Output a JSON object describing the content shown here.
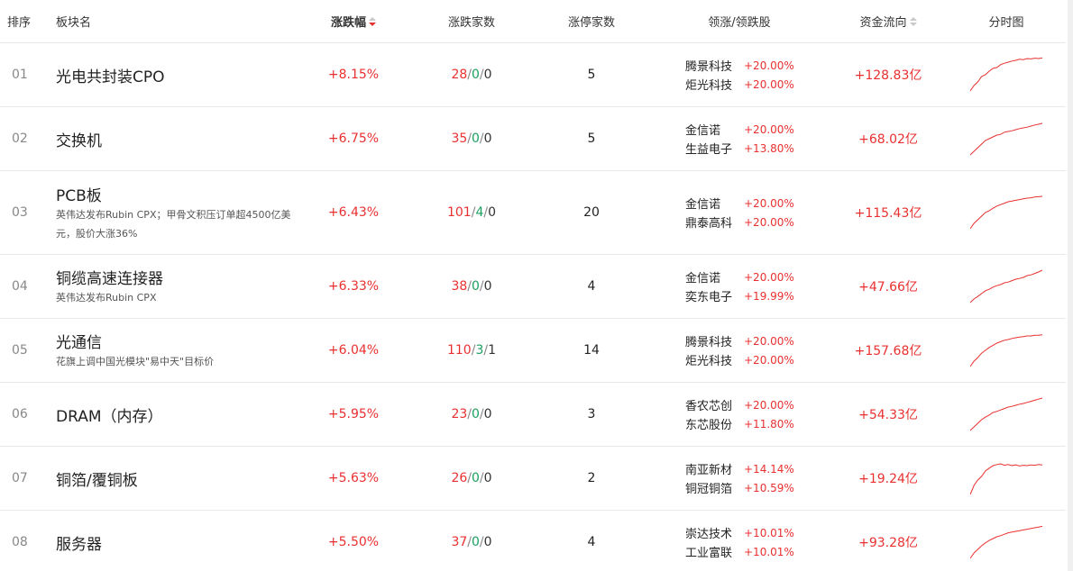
{
  "headers": {
    "rank": "排序",
    "name": "板块名",
    "change": "涨跌幅",
    "count": "涨跌家数",
    "limit_up": "涨停家数",
    "leaders": "领涨/领跌股",
    "flow": "资金流向",
    "timeline": "分时图"
  },
  "rows": [
    {
      "rank": "01",
      "name": "光电共封装CPO",
      "sub": "",
      "change": "+8.15%",
      "up": "28",
      "flat": "0",
      "down": "0",
      "limit": "5",
      "leader1": "腾景科技",
      "leader1_pct": "+20.00%",
      "leader2": "炬光科技",
      "leader2_pct": "+20.00%",
      "flow": "+128.83亿",
      "spark": [
        0.05,
        0.2,
        0.3,
        0.45,
        0.5,
        0.6,
        0.68,
        0.7,
        0.78,
        0.82,
        0.85,
        0.88,
        0.9,
        0.93,
        0.92,
        0.95,
        0.94,
        0.96,
        0.95,
        0.97
      ]
    },
    {
      "rank": "02",
      "name": "交换机",
      "sub": "",
      "change": "+6.75%",
      "up": "35",
      "flat": "0",
      "down": "0",
      "limit": "5",
      "leader1": "金信诺",
      "leader1_pct": "+20.00%",
      "leader2": "生益电子",
      "leader2_pct": "+13.80%",
      "flow": "+68.02亿",
      "spark": [
        0.05,
        0.15,
        0.25,
        0.35,
        0.45,
        0.5,
        0.55,
        0.6,
        0.62,
        0.68,
        0.7,
        0.72,
        0.75,
        0.78,
        0.8,
        0.82,
        0.85,
        0.88,
        0.9,
        0.93
      ]
    },
    {
      "rank": "03",
      "name": "PCB板",
      "sub": "英伟达发布Rubin CPX；甲骨文积压订单超4500亿美元，股价大涨36%",
      "change": "+6.43%",
      "up": "101",
      "flat": "4",
      "down": "0",
      "limit": "20",
      "leader1": "金信诺",
      "leader1_pct": "+20.00%",
      "leader2": "鼎泰高科",
      "leader2_pct": "+20.00%",
      "flow": "+115.43亿",
      "spark": [
        0.05,
        0.2,
        0.3,
        0.4,
        0.5,
        0.55,
        0.62,
        0.68,
        0.72,
        0.76,
        0.8,
        0.82,
        0.84,
        0.86,
        0.88,
        0.9,
        0.91,
        0.93,
        0.94,
        0.95
      ]
    },
    {
      "rank": "04",
      "name": "铜缆高速连接器",
      "sub": "英伟达发布Rubin CPX",
      "change": "+6.33%",
      "up": "38",
      "flat": "0",
      "down": "0",
      "limit": "4",
      "leader1": "金信诺",
      "leader1_pct": "+20.00%",
      "leader2": "奕东电子",
      "leader2_pct": "+19.99%",
      "flow": "+47.66亿",
      "spark": [
        0.05,
        0.15,
        0.22,
        0.3,
        0.38,
        0.42,
        0.48,
        0.52,
        0.55,
        0.6,
        0.62,
        0.66,
        0.7,
        0.72,
        0.75,
        0.8,
        0.82,
        0.86,
        0.9,
        0.95
      ]
    },
    {
      "rank": "05",
      "name": "光通信",
      "sub": "花旗上调中国光模块\"易中天\"目标价",
      "change": "+6.04%",
      "up": "110",
      "flat": "3",
      "down": "1",
      "limit": "14",
      "leader1": "腾景科技",
      "leader1_pct": "+20.00%",
      "leader2": "炬光科技",
      "leader2_pct": "+20.00%",
      "flow": "+157.68亿",
      "spark": [
        0.05,
        0.2,
        0.3,
        0.42,
        0.5,
        0.58,
        0.64,
        0.7,
        0.74,
        0.78,
        0.8,
        0.83,
        0.85,
        0.87,
        0.88,
        0.9,
        0.9,
        0.92,
        0.92,
        0.93
      ]
    },
    {
      "rank": "06",
      "name": "DRAM（内存）",
      "sub": "",
      "change": "+5.95%",
      "up": "23",
      "flat": "0",
      "down": "0",
      "limit": "3",
      "leader1": "香农芯创",
      "leader1_pct": "+20.00%",
      "leader2": "东芯股份",
      "leader2_pct": "+11.80%",
      "flow": "+54.33亿",
      "spark": [
        0.05,
        0.15,
        0.25,
        0.35,
        0.42,
        0.48,
        0.55,
        0.58,
        0.62,
        0.66,
        0.7,
        0.72,
        0.75,
        0.78,
        0.8,
        0.83,
        0.86,
        0.89,
        0.92,
        0.95
      ]
    },
    {
      "rank": "07",
      "name": "铜箔/覆铜板",
      "sub": "",
      "change": "+5.63%",
      "up": "26",
      "flat": "0",
      "down": "0",
      "limit": "2",
      "leader1": "南亚新材",
      "leader1_pct": "+14.14%",
      "leader2": "铜冠铜箔",
      "leader2_pct": "+10.59%",
      "flow": "+19.24亿",
      "spark": [
        0.05,
        0.3,
        0.45,
        0.55,
        0.7,
        0.78,
        0.85,
        0.88,
        0.9,
        0.86,
        0.88,
        0.85,
        0.87,
        0.84,
        0.86,
        0.85,
        0.87,
        0.86,
        0.88,
        0.87
      ]
    },
    {
      "rank": "08",
      "name": "服务器",
      "sub": "",
      "change": "+5.50%",
      "up": "37",
      "flat": "0",
      "down": "0",
      "limit": "4",
      "leader1": "崇达技术",
      "leader1_pct": "+10.01%",
      "leader2": "工业富联",
      "leader2_pct": "+10.01%",
      "flow": "+93.28亿",
      "spark": [
        0.05,
        0.2,
        0.3,
        0.4,
        0.48,
        0.55,
        0.6,
        0.65,
        0.68,
        0.72,
        0.76,
        0.78,
        0.8,
        0.82,
        0.84,
        0.86,
        0.88,
        0.9,
        0.92,
        0.94
      ]
    }
  ],
  "colors": {
    "up": "#e93030",
    "flat": "#19a15f",
    "line": "#e93030"
  }
}
